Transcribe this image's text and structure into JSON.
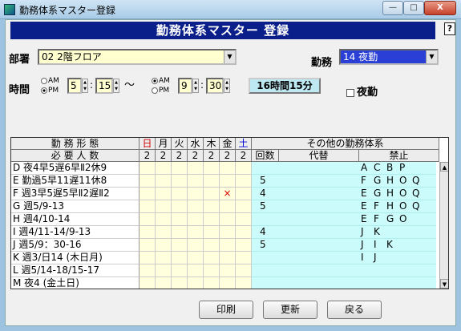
{
  "window": {
    "title": "勤務体系マスター登録",
    "min": "—",
    "max": "□",
    "close": "X"
  },
  "header": {
    "title": "勤務体系マスター 登録",
    "help": "?"
  },
  "form": {
    "dept_label": "部署",
    "dept_value": "02 2階フロア",
    "shift_label": "勤務",
    "shift_value": "14 夜勤",
    "time_label": "時間",
    "am": "AM",
    "pm": "PM",
    "start_ampm": "PM",
    "start_hour": "5",
    "start_min": "15",
    "tilde": "～",
    "colon": ":",
    "end_ampm": "AM",
    "end_hour": "9",
    "end_min": "30",
    "duration": "16時間15分",
    "night_label": "夜勤",
    "night_checked": false
  },
  "grid": {
    "left_header": "勤 務 形 態",
    "left_sub": "必 要 人 数",
    "days": [
      {
        "label": "日",
        "color": "#d00000"
      },
      {
        "label": "月",
        "color": "#000000"
      },
      {
        "label": "火",
        "color": "#000000"
      },
      {
        "label": "水",
        "color": "#000000"
      },
      {
        "label": "木",
        "color": "#000000"
      },
      {
        "label": "金",
        "color": "#000000"
      },
      {
        "label": "土",
        "color": "#0000d0"
      }
    ],
    "required": [
      "2",
      "2",
      "2",
      "2",
      "2",
      "2",
      "2"
    ],
    "other_header": "その他の勤務体系",
    "col_count": "回数",
    "col_sub": "代替",
    "col_forbid": "禁止",
    "rows": [
      {
        "name": "D 夜4早5遅6早Ⅱ2休9",
        "count": "",
        "sub": "",
        "forbid": [
          "A",
          "C",
          "B",
          "P",
          "",
          ""
        ],
        "marks": [
          "",
          "",
          "",
          "",
          "",
          "",
          ""
        ]
      },
      {
        "name": "E 勤過5早11遅11休8",
        "count": "5",
        "sub": "",
        "forbid": [
          "F",
          "G",
          "H",
          "O",
          "Q",
          ""
        ],
        "marks": [
          "",
          "",
          "",
          "",
          "",
          "",
          ""
        ]
      },
      {
        "name": "F 週3早5遅5早Ⅱ2遅Ⅱ2",
        "count": "4",
        "sub": "",
        "forbid": [
          "E",
          "G",
          "H",
          "O",
          "Q",
          ""
        ],
        "marks": [
          "",
          "",
          "",
          "",
          "",
          "×",
          ""
        ]
      },
      {
        "name": "G 週5/9-13",
        "count": "5",
        "sub": "",
        "forbid": [
          "E",
          "F",
          "H",
          "O",
          "Q",
          ""
        ],
        "marks": [
          "",
          "",
          "",
          "",
          "",
          "",
          ""
        ]
      },
      {
        "name": "H 週4/10-14",
        "count": "",
        "sub": "",
        "forbid": [
          "E",
          "F",
          "G",
          "O",
          "",
          ""
        ],
        "marks": [
          "",
          "",
          "",
          "",
          "",
          "",
          ""
        ]
      },
      {
        "name": "I 週4/11-14/9-13",
        "count": "4",
        "sub": "",
        "forbid": [
          "J",
          "K",
          "",
          "",
          "",
          ""
        ],
        "marks": [
          "",
          "",
          "",
          "",
          "",
          "",
          ""
        ]
      },
      {
        "name": "J 週5/9：30-16",
        "count": "5",
        "sub": "",
        "forbid": [
          "J",
          "I",
          "K",
          "",
          "",
          ""
        ],
        "marks": [
          "",
          "",
          "",
          "",
          "",
          "",
          ""
        ]
      },
      {
        "name": "K 週3/日14 (木日月)",
        "count": "",
        "sub": "",
        "forbid": [
          "I",
          "J",
          "",
          "",
          "",
          ""
        ],
        "marks": [
          "",
          "",
          "",
          "",
          "",
          "",
          ""
        ]
      },
      {
        "name": "L 週5/14-18/15-17",
        "count": "",
        "sub": "",
        "forbid": [
          "",
          "",
          "",
          "",
          "",
          ""
        ],
        "marks": [
          "",
          "",
          "",
          "",
          "",
          "",
          ""
        ]
      },
      {
        "name": "M 夜4 (金土日)",
        "count": "",
        "sub": "",
        "forbid": [
          "",
          "",
          "",
          "",
          "",
          ""
        ],
        "marks": [
          "",
          "",
          "",
          "",
          "",
          "",
          ""
        ]
      }
    ]
  },
  "buttons": {
    "print": "印刷",
    "update": "更新",
    "back": "戻る"
  }
}
